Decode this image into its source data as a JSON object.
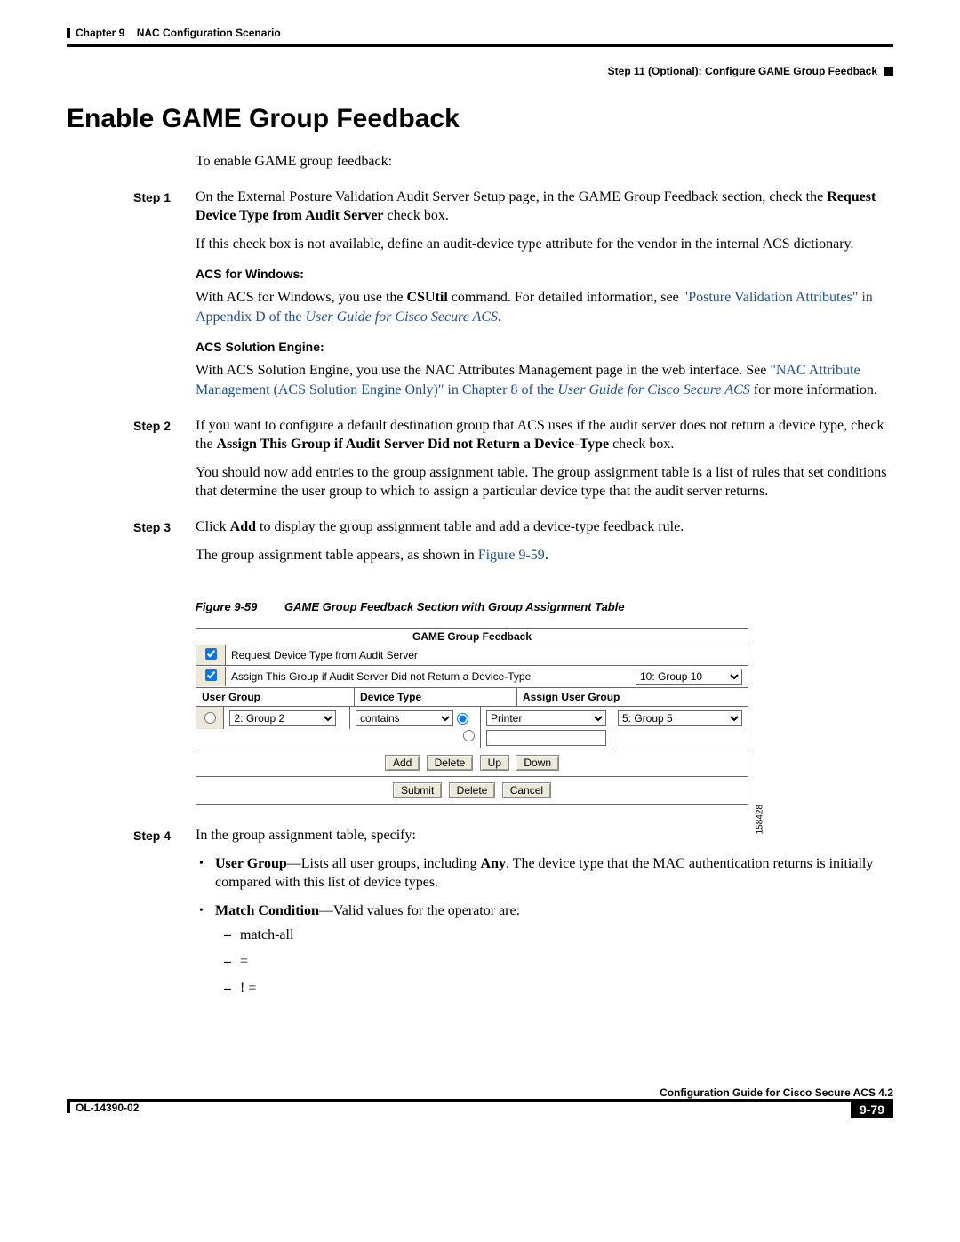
{
  "header": {
    "chapter_label": "Chapter 9",
    "chapter_title": "NAC Configuration Scenario",
    "step_label": "Step 11 (Optional): Configure GAME Group Feedback"
  },
  "title": "Enable GAME Group Feedback",
  "intro": "To enable GAME group feedback:",
  "steps": {
    "s1": {
      "label": "Step 1",
      "p1a": "On the External Posture Validation Audit Server Setup page, in the GAME Group Feedback section, check the ",
      "p1b": "Request Device Type from Audit Server",
      "p1c": " check box.",
      "p2": "If this check box is not available, define an audit-device type attribute for the vendor in the internal ACS dictionary.",
      "win_h": "ACS for Windows:",
      "win_a": "With ACS for Windows, you use the ",
      "win_b": "CSUtil",
      "win_c": " command. For detailed information, see ",
      "win_link1": "\"Posture Validation Attributes\" in Appendix D of the",
      "win_link2": "User Guide for Cisco Secure ACS",
      "sol_h": "ACS Solution Engine:",
      "sol_a": "With ACS Solution Engine, you use the NAC Attributes Management page in the web interface. See ",
      "sol_link1": "\"NAC Attribute Management (ACS Solution Engine Only)\" in Chapter 8 of the",
      "sol_link2": "User Guide for Cisco Secure ACS",
      "sol_b": "for more information."
    },
    "s2": {
      "label": "Step 2",
      "p1a": "If you want to configure a default destination group that ACS uses if the audit server does not return a device type, check the ",
      "p1b": "Assign This Group if Audit Server Did not Return a Device-Type",
      "p1c": " check box.",
      "p2": "You should now add entries to the group assignment table. The group assignment table is a list of rules that set conditions that determine the user group to which to assign a particular device type that the audit server returns."
    },
    "s3": {
      "label": "Step 3",
      "p1a": "Click ",
      "p1b": "Add",
      "p1c": " to display the group assignment table and add a device-type feedback rule.",
      "p2a": "The group assignment table appears, as shown in ",
      "p2link": "Figure 9-59",
      "p2b": "."
    },
    "s4": {
      "label": "Step 4",
      "p1": "In the group assignment table, specify:",
      "b1a": "User Group",
      "b1b": "—Lists all user groups, including ",
      "b1c": "Any",
      "b1d": ". The device type that the MAC authentication returns is initially compared with this list of device types.",
      "b2a": "Match Condition",
      "b2b": "—Valid values for the operator are:",
      "d1": "match-all",
      "d2": "=",
      "d3": "! ="
    }
  },
  "figure": {
    "label": "Figure 9-59",
    "caption": "GAME Group Feedback Section with Group Assignment Table",
    "id": "158428",
    "title": "GAME Group Feedback",
    "cb1_label": "Request Device Type from Audit Server",
    "cb2_label": "Assign This Group if Audit Server Did not Return a Device-Type",
    "cb2_select": "10: Group 10",
    "hdr_ug": "User Group",
    "hdr_dt": "Device Type",
    "hdr_aug": "Assign User Group",
    "row_ug": "2: Group 2",
    "row_op": "contains",
    "row_val": "Printer",
    "row_aug": "5: Group 5",
    "btn_add": "Add",
    "btn_delete": "Delete",
    "btn_up": "Up",
    "btn_down": "Down",
    "btn_submit": "Submit",
    "btn_delete2": "Delete",
    "btn_cancel": "Cancel"
  },
  "footer": {
    "doc_id": "OL-14390-02",
    "guide": "Configuration Guide for Cisco Secure ACS 4.2",
    "page": "9-79"
  }
}
